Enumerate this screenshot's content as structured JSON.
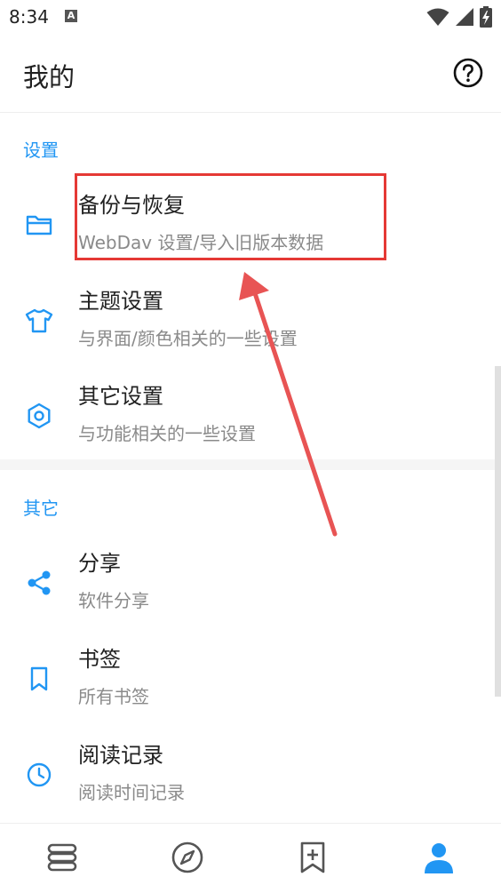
{
  "status_bar": {
    "time": "8:34",
    "notification": "A"
  },
  "app_bar": {
    "title": "我的"
  },
  "sections": [
    {
      "header": "设置",
      "items": [
        {
          "title": "备份与恢复",
          "subtitle": "WebDav 设置/导入旧版本数据",
          "icon": "folder-icon"
        },
        {
          "title": "主题设置",
          "subtitle": "与界面/颜色相关的一些设置",
          "icon": "tshirt-icon"
        },
        {
          "title": "其它设置",
          "subtitle": "与功能相关的一些设置",
          "icon": "hexagon-gear-icon"
        }
      ]
    },
    {
      "header": "其它",
      "items": [
        {
          "title": "分享",
          "subtitle": "软件分享",
          "icon": "share-icon"
        },
        {
          "title": "书签",
          "subtitle": "所有书签",
          "icon": "bookmark-icon"
        },
        {
          "title": "阅读记录",
          "subtitle": "阅读时间记录",
          "icon": "clock-icon"
        }
      ]
    }
  ],
  "bottom_nav": [
    {
      "icon": "bookshelf-icon",
      "active": false
    },
    {
      "icon": "compass-icon",
      "active": false
    },
    {
      "icon": "bookmark-add-icon",
      "active": false
    },
    {
      "icon": "person-icon",
      "active": true
    }
  ],
  "colors": {
    "accent": "#2196F3",
    "annotation": "#e53935",
    "subtitle": "#8a8a8a",
    "inactive_icon": "#555555"
  }
}
